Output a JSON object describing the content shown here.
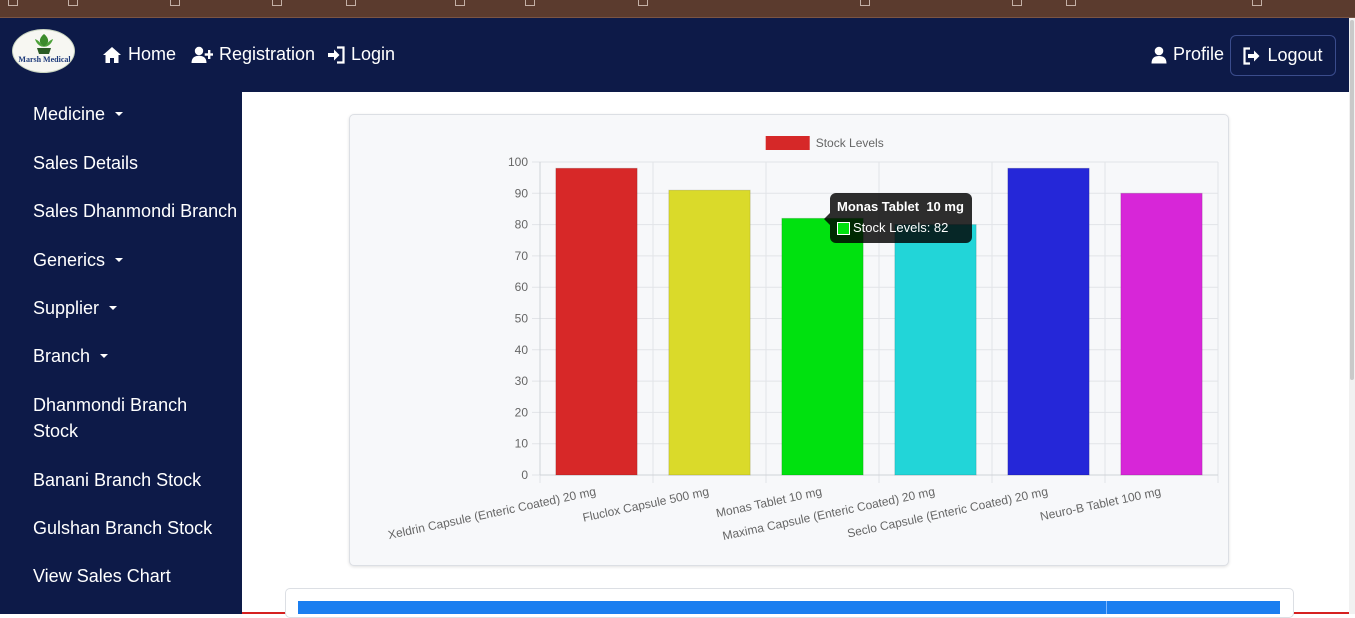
{
  "brand": {
    "logo_text": "Marsh Medical"
  },
  "navbar": {
    "home": "Home",
    "registration": "Registration",
    "login": "Login",
    "profile": "Profile",
    "logout": "Logout"
  },
  "sidebar": {
    "items": [
      {
        "label": "Medicine",
        "dropdown": true
      },
      {
        "label": "Sales Details",
        "dropdown": false
      },
      {
        "label": "Sales Dhanmondi Branch",
        "dropdown": false
      },
      {
        "label": "Generics",
        "dropdown": true
      },
      {
        "label": "Supplier",
        "dropdown": true
      },
      {
        "label": "Branch",
        "dropdown": true
      },
      {
        "label": "Dhanmondi Branch",
        "dropdown": false
      },
      {
        "label": "Stock",
        "dropdown": false
      },
      {
        "label": "Banani Branch Stock",
        "dropdown": false
      },
      {
        "label": "Gulshan Branch Stock",
        "dropdown": false
      },
      {
        "label": "View Sales Chart",
        "dropdown": false
      }
    ]
  },
  "chart_data": {
    "type": "bar",
    "title": "",
    "legend": {
      "label": "Stock Levels",
      "color": "#d62828",
      "placement": "top-center"
    },
    "categories": [
      "Xeldrin Capsule (Enteric Coated) 20 mg",
      "Fluclox Capsule 500 mg",
      "Monas Tablet  10 mg",
      "Maxima Capsule (Enteric Coated) 20 mg",
      "Seclo Capsule (Enteric Coated) 20 mg",
      "Neuro-B Tablet 100 mg"
    ],
    "series": [
      {
        "name": "Stock Levels",
        "values": [
          98,
          91,
          82,
          80,
          98,
          90
        ],
        "colors": [
          "#d72828",
          "#dada2a",
          "#00e10f",
          "#22d5d8",
          "#2527d8",
          "#d726d8"
        ]
      }
    ],
    "ylim": [
      0,
      100
    ],
    "yticks": [
      0,
      10,
      20,
      30,
      40,
      50,
      60,
      70,
      80,
      90,
      100
    ],
    "grid": true
  },
  "tooltip": {
    "title": "Monas Tablet  10 mg",
    "line": "Stock Levels: 82",
    "swatch_color": "#00e10f"
  }
}
